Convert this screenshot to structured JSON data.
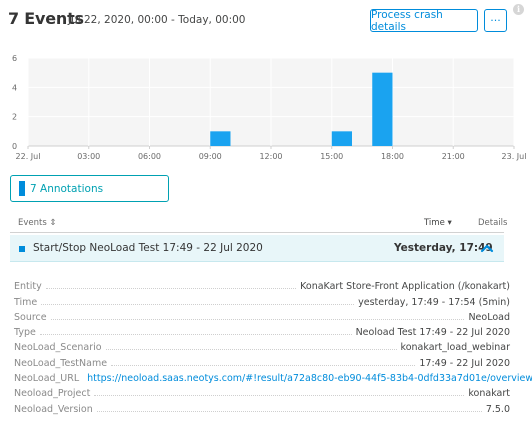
{
  "header": {
    "title": "7 Events",
    "subtitle": "Jul 22, 2020, 00:00 - Today, 00:00",
    "process_crash_label": "Process crash details",
    "more_label": "···",
    "info_label": "i"
  },
  "chart_data": {
    "type": "bar",
    "ylim": [
      0,
      6
    ],
    "yticks": [
      0,
      2,
      4,
      6
    ],
    "xtick_labels": [
      "22. Jul",
      "03:00",
      "06:00",
      "09:00",
      "12:00",
      "15:00",
      "18:00",
      "21:00",
      "23. Jul"
    ],
    "x_hours": [
      0,
      3,
      6,
      9,
      12,
      15,
      18,
      21,
      24
    ],
    "bars": [
      {
        "start_hour": 9,
        "end_hour": 10,
        "value": 1
      },
      {
        "start_hour": 15,
        "end_hour": 16,
        "value": 1
      },
      {
        "start_hour": 17,
        "end_hour": 18,
        "value": 5
      }
    ],
    "bar_color": "#1aa3f0",
    "grid": true
  },
  "annotations": {
    "label": "7 Annotations"
  },
  "table": {
    "col_events": "Events ⇕",
    "col_time": "Time ▾",
    "col_details": "Details"
  },
  "event": {
    "name": "Start/Stop NeoLoad Test 17:49 - 22 Jul 2020",
    "time": "Yesterday, 17:49"
  },
  "details": [
    {
      "key": "Entity",
      "value": "KonaKart Store-Front Application (/konakart)",
      "link": false
    },
    {
      "key": "Time",
      "value": "yesterday, 17:49 - 17:54 (5min)",
      "link": false
    },
    {
      "key": "Source",
      "value": "NeoLoad",
      "link": false
    },
    {
      "key": "Type",
      "value": "Neoload Test 17:49 - 22 Jul 2020",
      "link": false
    },
    {
      "key": "NeoLoad_Scenario",
      "value": "konakart_load_webinar",
      "link": false
    },
    {
      "key": "NeoLoad_TestName",
      "value": "17:49 - 22 Jul 2020",
      "link": false
    },
    {
      "key": "NeoLoad_URL",
      "value": "https://neoload.saas.neotys.com/#!result/a72a8c80-eb90-44f5-83b4-0dfd33a7d01e/overview",
      "link": true
    },
    {
      "key": "Neoload_Project",
      "value": "konakart",
      "link": false
    },
    {
      "key": "Neoload_Version",
      "value": "7.5.0",
      "link": false
    }
  ]
}
